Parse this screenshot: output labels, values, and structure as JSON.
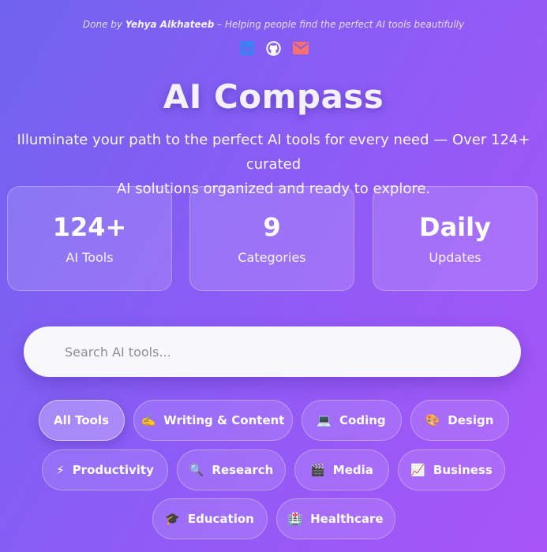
{
  "credit": {
    "prefix": "Done by ",
    "author": "Yehya Alkhateeb",
    "suffix": " – Helping people find the perfect AI tools beautifully"
  },
  "social": {
    "linkedin": {
      "icon": "linkedin-icon",
      "color": "#3b82f6"
    },
    "github": {
      "icon": "github-icon",
      "color": "#ffffff"
    },
    "email": {
      "icon": "mail-icon",
      "color": "#f87171"
    }
  },
  "hero": {
    "title": "AI Compass",
    "subtitle_line1": "Illuminate your path to the perfect AI tools for every need — Over 124+ curated",
    "subtitle_line2": "AI solutions organized and ready to explore."
  },
  "stats": [
    {
      "value": "124+",
      "label": "AI Tools"
    },
    {
      "value": "9",
      "label": "Categories"
    },
    {
      "value": "Daily",
      "label": "Updates"
    }
  ],
  "search": {
    "placeholder": "Search AI tools...",
    "value": ""
  },
  "categories": {
    "all": {
      "label": "All Tools",
      "active": true
    },
    "items": [
      {
        "label": "Writing & Content",
        "icon": "writing-hand-icon",
        "glyph": "✍️"
      },
      {
        "label": "Coding",
        "icon": "laptop-icon",
        "glyph": "💻"
      },
      {
        "label": "Design",
        "icon": "palette-icon",
        "glyph": "🎨"
      },
      {
        "label": "Productivity",
        "icon": "lightning-icon",
        "glyph": "⚡"
      },
      {
        "label": "Research",
        "icon": "magnifier-icon",
        "glyph": "🔍"
      },
      {
        "label": "Media",
        "icon": "clapper-icon",
        "glyph": "🎬"
      },
      {
        "label": "Business",
        "icon": "chart-increasing-icon",
        "glyph": "📈"
      },
      {
        "label": "Education",
        "icon": "graduation-cap-icon",
        "glyph": "🎓"
      },
      {
        "label": "Healthcare",
        "icon": "medical-icon",
        "glyph": "🏥"
      }
    ]
  },
  "colors": {
    "gradient_start": "#6f63ee",
    "gradient_end": "#a855f7",
    "search_bg": "#f8f8fc"
  }
}
